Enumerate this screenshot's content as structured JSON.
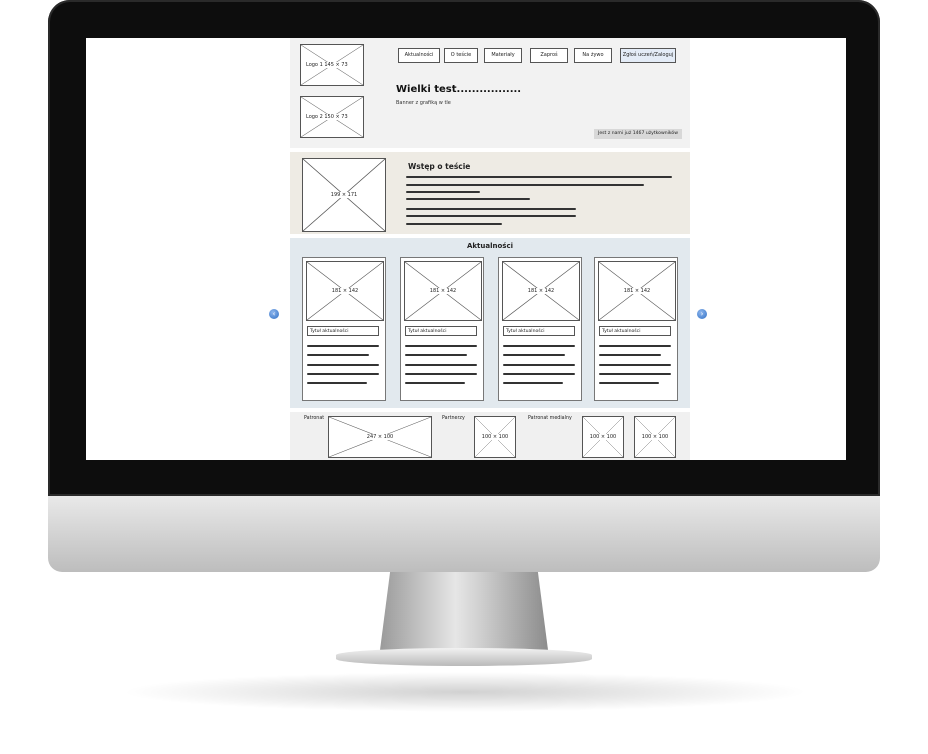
{
  "nav": {
    "items": [
      "Aktualności",
      "O teście",
      "Materiały",
      "Zaproś",
      "Na żywo",
      "Zgłoś uczeń/Zaloguj"
    ]
  },
  "header": {
    "logo1": "Logo 1 145 × 73",
    "logo2": "Logo 2 150 × 73",
    "title": "Wielki test.................",
    "subtitle": "Banner z grafiką w tle",
    "users_badge": "Jest z nami już 1467 użytkowników"
  },
  "intro": {
    "image": "199 × 171",
    "title": "Wstęp o teście"
  },
  "news": {
    "title": "Aktualności",
    "cards": [
      {
        "image": "181 × 142",
        "title": "Tytuł aktualności"
      },
      {
        "image": "181 × 142",
        "title": "Tytuł aktualności"
      },
      {
        "image": "181 × 142",
        "title": "Tytuł aktualności"
      },
      {
        "image": "181 × 142",
        "title": "Tytuł aktualności"
      }
    ],
    "prev_icon": "chevron-left-icon",
    "next_icon": "chevron-right-icon"
  },
  "footer": {
    "patron_label": "Patronat",
    "patron_image": "247 × 100",
    "partners_label": "Partnerzy",
    "partners_image": "100 × 100",
    "media_label": "Patronat medialny",
    "media_images": [
      "100 × 100",
      "100 × 100"
    ]
  }
}
